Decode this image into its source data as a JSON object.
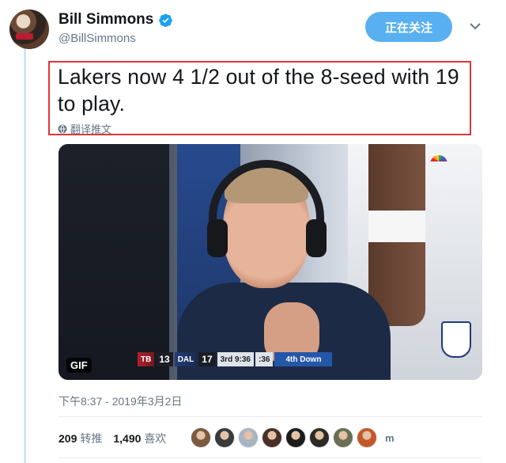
{
  "user": {
    "display_name": "Bill Simmons",
    "handle": "@BillSimmons",
    "verified_icon": "verified-badge-icon"
  },
  "follow_button": {
    "label": "正在关注",
    "color": "#59b0f0"
  },
  "tweet": {
    "text": "Lakers now 4 1/2 out of the 8-seed with 19 to play.",
    "translate_label": "翻译推文",
    "timestamp": "下午8:37 - 2019年3月2日"
  },
  "media": {
    "badge": "GIF",
    "scoreboard": {
      "team1": "TB",
      "score1": "13",
      "team2": "DAL",
      "score2": "17",
      "quarter_clock": "3rd 9:36",
      "play_clock": ":36",
      "down": "4th Down"
    }
  },
  "stats": {
    "retweets_count": "209",
    "retweets_label": "转推",
    "likes_count": "1,490",
    "likes_label": "喜欢",
    "more_likers": "m"
  },
  "colors": {
    "accent": "#59b0f0",
    "highlight_border": "#e0353c",
    "secondary_text": "#657786"
  },
  "likers": [
    {
      "color": "#7b5a3e"
    },
    {
      "color": "#3a3a3a"
    },
    {
      "color": "#a9b4c2"
    },
    {
      "color": "#4a2f28"
    },
    {
      "color": "#1c1c1c"
    },
    {
      "color": "#2e2a26"
    },
    {
      "color": "#6b6f52"
    },
    {
      "color": "#c4572a"
    }
  ]
}
